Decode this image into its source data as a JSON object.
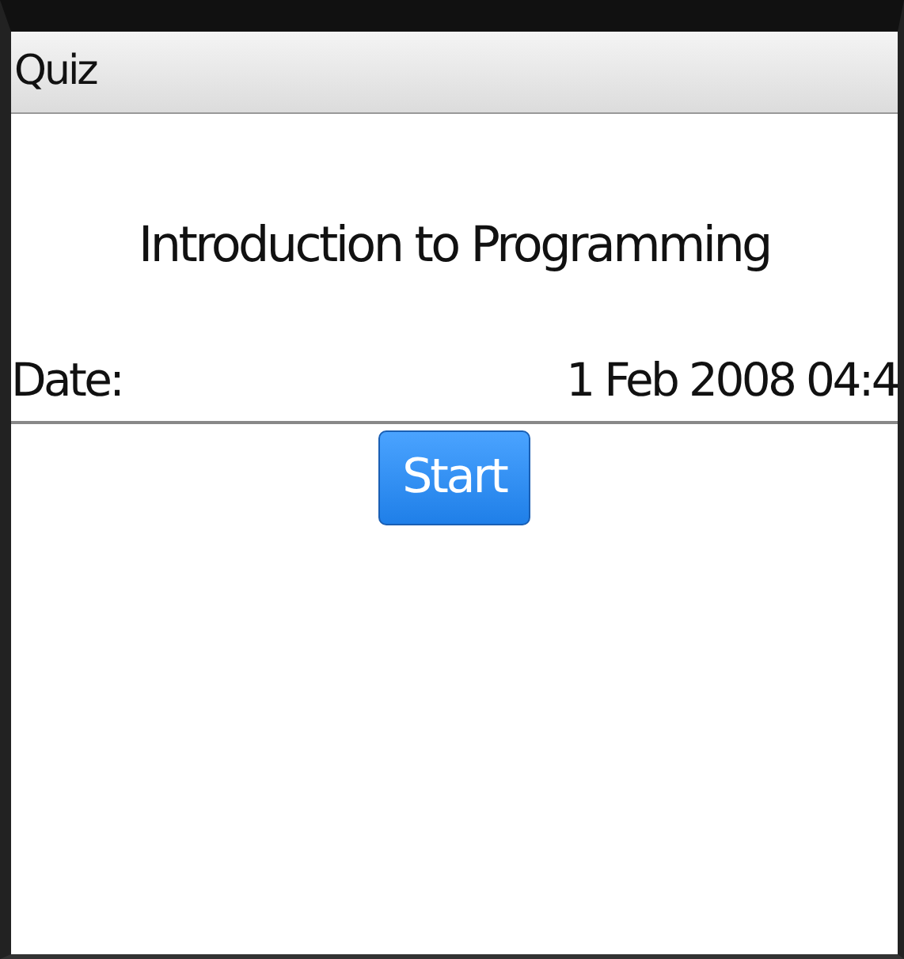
{
  "window": {
    "title": "Quiz"
  },
  "heading": "Introduction to Programming",
  "date": {
    "label": "Date:",
    "value": "1 Feb 2008 04:4"
  },
  "buttons": [
    {
      "label": "Start",
      "selected": true
    }
  ]
}
